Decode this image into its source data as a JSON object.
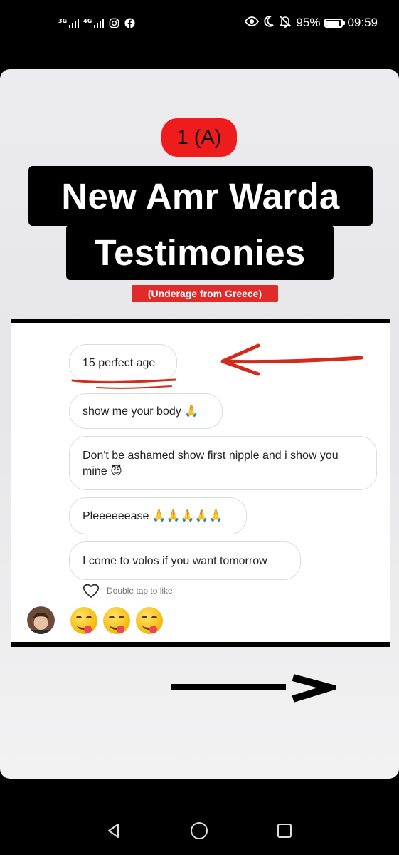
{
  "status_bar": {
    "network_1": "3G",
    "network_2": "4G",
    "battery_percent": "95%",
    "battery_level": 0.95,
    "time": "09:59",
    "left_icons": [
      "signal-icon",
      "signal-icon",
      "instagram-icon",
      "facebook-icon"
    ],
    "right_icons": [
      "eye-icon",
      "moon-icon",
      "bell-off-icon",
      "battery-icon"
    ]
  },
  "story": {
    "badge": "1 (A)",
    "title_line_1": "New Amr Warda",
    "title_line_2": "Testimonies",
    "subtitle": "(Underage from Greece)",
    "colors": {
      "badge": "#ee1c1c",
      "subtitle_bg": "#e12a2a",
      "annotation_red": "#d42a1c"
    }
  },
  "chat_screenshot": {
    "messages": [
      {
        "text": "15 perfect age",
        "emoji": ""
      },
      {
        "text": "show me your body",
        "emoji": "🙏"
      },
      {
        "text": "Don't be ashamed show first nipple and i show you mine",
        "emoji": "😈"
      },
      {
        "text": "Pleeeeeease",
        "emoji": "🙏🙏🙏🙏🙏"
      },
      {
        "text": "I come to volos if you want tomorrow",
        "emoji": ""
      }
    ],
    "like_hint": "Double tap to like",
    "reaction_emojis": [
      "😋",
      "😋",
      "😋"
    ]
  },
  "nav_bar": {
    "icons": [
      "back-icon",
      "home-icon",
      "recents-icon"
    ]
  }
}
